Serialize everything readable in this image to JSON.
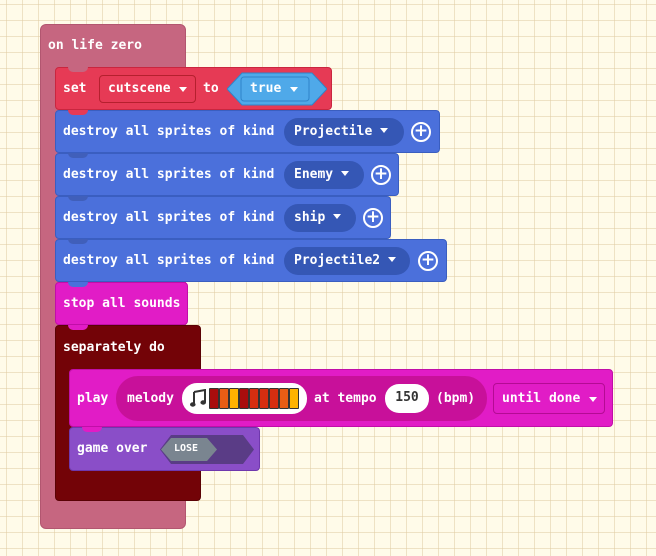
{
  "event": {
    "label": "on life zero",
    "color": "#c66680"
  },
  "set_block": {
    "keyword": "set",
    "variable": "cutscene",
    "to_label": "to",
    "value": "true",
    "color": "#e63a55",
    "value_color": "#4fa9e9"
  },
  "destroy_blocks": [
    {
      "label": "destroy all sprites of kind",
      "kind": "Projectile"
    },
    {
      "label": "destroy all sprites of kind",
      "kind": "Enemy"
    },
    {
      "label": "destroy all sprites of kind",
      "kind": "ship"
    },
    {
      "label": "destroy all sprites of kind",
      "kind": "Projectile2"
    }
  ],
  "destroy_color": "#4b70db",
  "stop_block": {
    "label": "stop all sounds",
    "color": "#e11cc6"
  },
  "separately": {
    "label": "separately do",
    "color": "#730307"
  },
  "play_block": {
    "play_label": "play",
    "melody_label": "melody",
    "music_icon": "music-note-icon",
    "note_colors": [
      "#a90d0d",
      "#ea5d15",
      "#ffb300",
      "#a90d0d",
      "#d62e10",
      "#d62e10",
      "#d62e10",
      "#ea5d15",
      "#ffb300"
    ],
    "tempo_label": "at tempo",
    "tempo": "150",
    "bpm_label": "(bpm)",
    "mode": "until done",
    "color": "#e11cc6"
  },
  "game_over": {
    "label": "game over",
    "result": "LOSE",
    "color": "#8a4ec8",
    "badge_color": "#7a8590"
  }
}
